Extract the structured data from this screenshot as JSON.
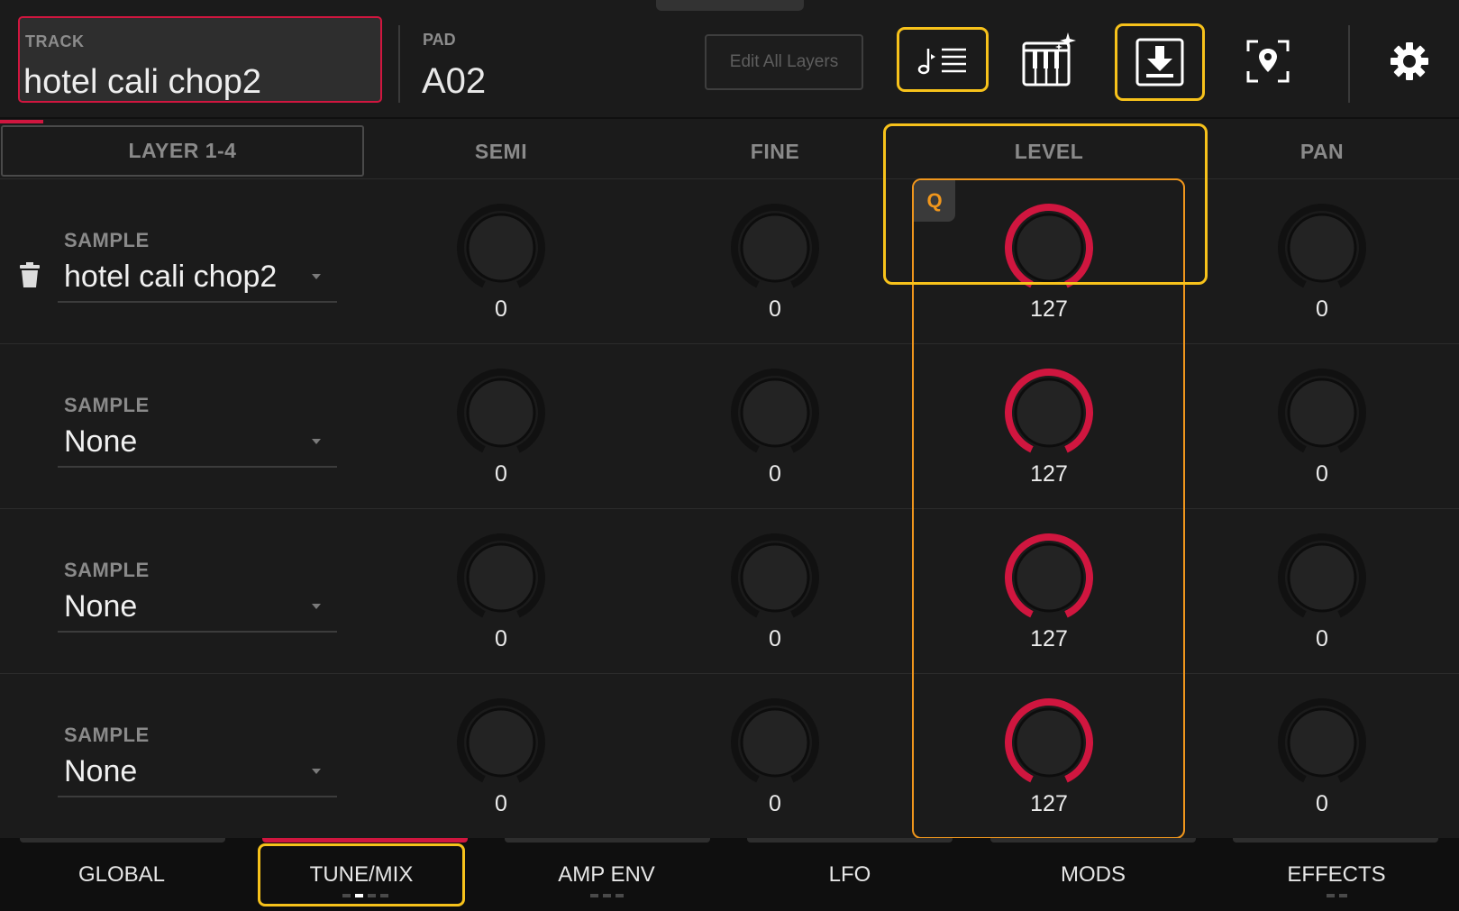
{
  "header": {
    "track_label": "TRACK",
    "track_name": "hotel cali chop2",
    "pad_label": "PAD",
    "pad_value": "A02",
    "edit_all_layers_label": "Edit All Layers",
    "icons": [
      "note-list-icon",
      "keyboard-sparkle-icon",
      "download-arrow-icon",
      "location-focus-icon",
      "gear-icon"
    ]
  },
  "columns": {
    "layer_tab": "LAYER 1-4",
    "semi": "SEMI",
    "fine": "FINE",
    "level": "LEVEL",
    "pan": "PAN"
  },
  "q_badge": "Q",
  "layers": [
    {
      "sample_label": "SAMPLE",
      "sample": "hotel cali chop2",
      "semi": "0",
      "fine": "0",
      "level": "127",
      "pan": "0"
    },
    {
      "sample_label": "SAMPLE",
      "sample": "None",
      "semi": "0",
      "fine": "0",
      "level": "127",
      "pan": "0"
    },
    {
      "sample_label": "SAMPLE",
      "sample": "None",
      "semi": "0",
      "fine": "0",
      "level": "127",
      "pan": "0"
    },
    {
      "sample_label": "SAMPLE",
      "sample": "None",
      "semi": "0",
      "fine": "0",
      "level": "127",
      "pan": "0"
    }
  ],
  "tabs": [
    {
      "label": "GLOBAL"
    },
    {
      "label": "TUNE/MIX"
    },
    {
      "label": "AMP ENV"
    },
    {
      "label": "LFO"
    },
    {
      "label": "MODS"
    },
    {
      "label": "EFFECTS"
    }
  ],
  "colors": {
    "accent_red": "#d0163f",
    "highlight_yellow": "#f7c21b",
    "q_orange": "#f0961c",
    "background": "#1b1b1b"
  }
}
